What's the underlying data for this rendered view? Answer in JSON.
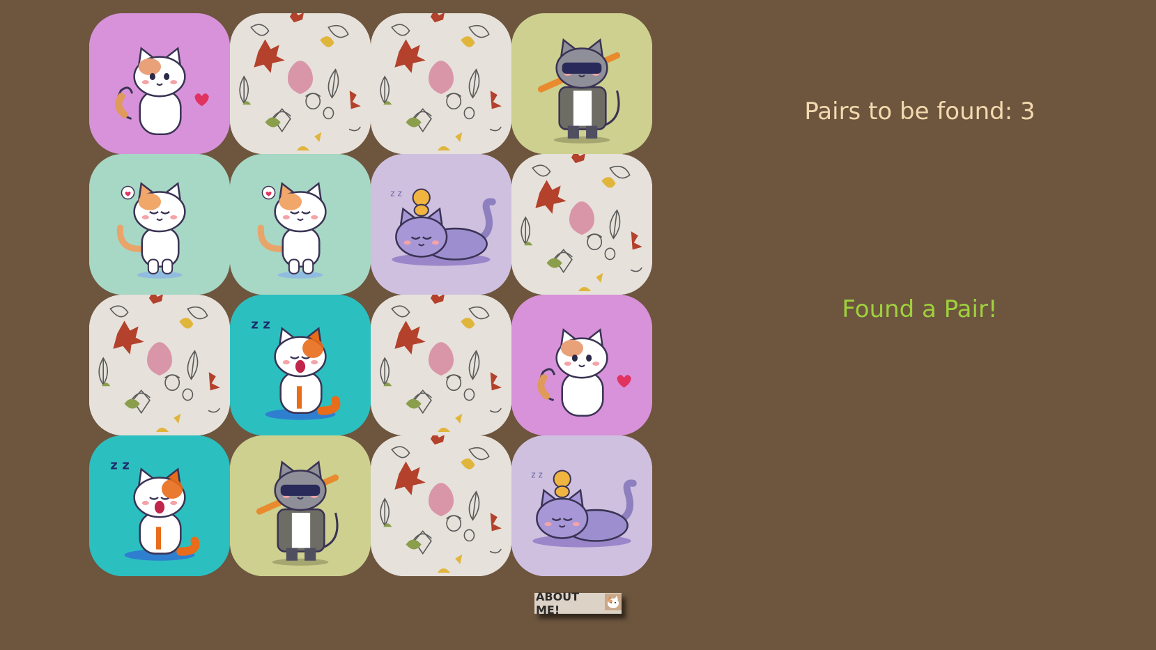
{
  "status": {
    "pairs_text": "Pairs to be found: 3",
    "message": "Found a Pair!"
  },
  "about_button": {
    "label": "ABOUT ME!",
    "icon": "cat-icon"
  },
  "colors": {
    "page_background": "#6d553e",
    "pairs_text": "#f3d9ae",
    "message_text": "#9fd13c",
    "card_back": "#e6e1da"
  },
  "cards": [
    {
      "state": "revealed",
      "design": "cat-heart",
      "bg": "#d892d9"
    },
    {
      "state": "hidden",
      "design": "leaf-back",
      "bg": "#e6e1da"
    },
    {
      "state": "hidden",
      "design": "leaf-back",
      "bg": "#e6e1da"
    },
    {
      "state": "revealed",
      "design": "cool-cat-sunglasses",
      "bg": "#cdd08f"
    },
    {
      "state": "revealed",
      "design": "cat-yoga",
      "bg": "#a7d7c5"
    },
    {
      "state": "revealed",
      "design": "cat-yoga",
      "bg": "#a7d7c5"
    },
    {
      "state": "revealed",
      "design": "sleeping-cat-chick",
      "bg": "#cfc0e0"
    },
    {
      "state": "hidden",
      "design": "leaf-back",
      "bg": "#e6e1da"
    },
    {
      "state": "hidden",
      "design": "leaf-back",
      "bg": "#e6e1da"
    },
    {
      "state": "revealed",
      "design": "yawning-cat",
      "bg": "#2cbfc0"
    },
    {
      "state": "hidden",
      "design": "leaf-back",
      "bg": "#e6e1da"
    },
    {
      "state": "revealed",
      "design": "cat-heart",
      "bg": "#d892d9"
    },
    {
      "state": "revealed",
      "design": "yawning-cat",
      "bg": "#2cbfc0"
    },
    {
      "state": "revealed",
      "design": "cool-cat-sunglasses",
      "bg": "#cdd08f"
    },
    {
      "state": "hidden",
      "design": "leaf-back",
      "bg": "#e6e1da"
    },
    {
      "state": "revealed",
      "design": "sleeping-cat-chick",
      "bg": "#cfc0e0"
    }
  ]
}
